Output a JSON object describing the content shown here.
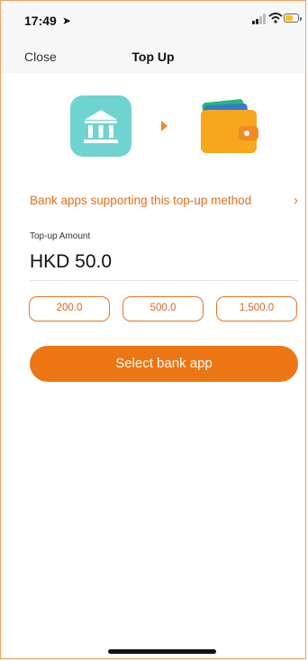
{
  "status_bar": {
    "time": "17:49",
    "location_icon": "location-arrow-icon",
    "battery_color": "#f5c518"
  },
  "navbar": {
    "close_label": "Close",
    "title": "Top Up"
  },
  "transfer_graphic": {
    "from_icon": "bank-icon",
    "arrow_icon": "play-arrow-icon",
    "to_icon": "wallet-icon"
  },
  "support_link": {
    "label": "Bank apps supporting this top-up method",
    "chevron": "›"
  },
  "amount": {
    "label": "Top-up Amount",
    "value": "HKD 50.0"
  },
  "presets": [
    "200.0",
    "500.0",
    "1,500.0"
  ],
  "cta": {
    "label": "Select bank app"
  },
  "colors": {
    "accent": "#ec7613",
    "bank_tile": "#6fd3cf",
    "text_orange": "#e56f18"
  }
}
